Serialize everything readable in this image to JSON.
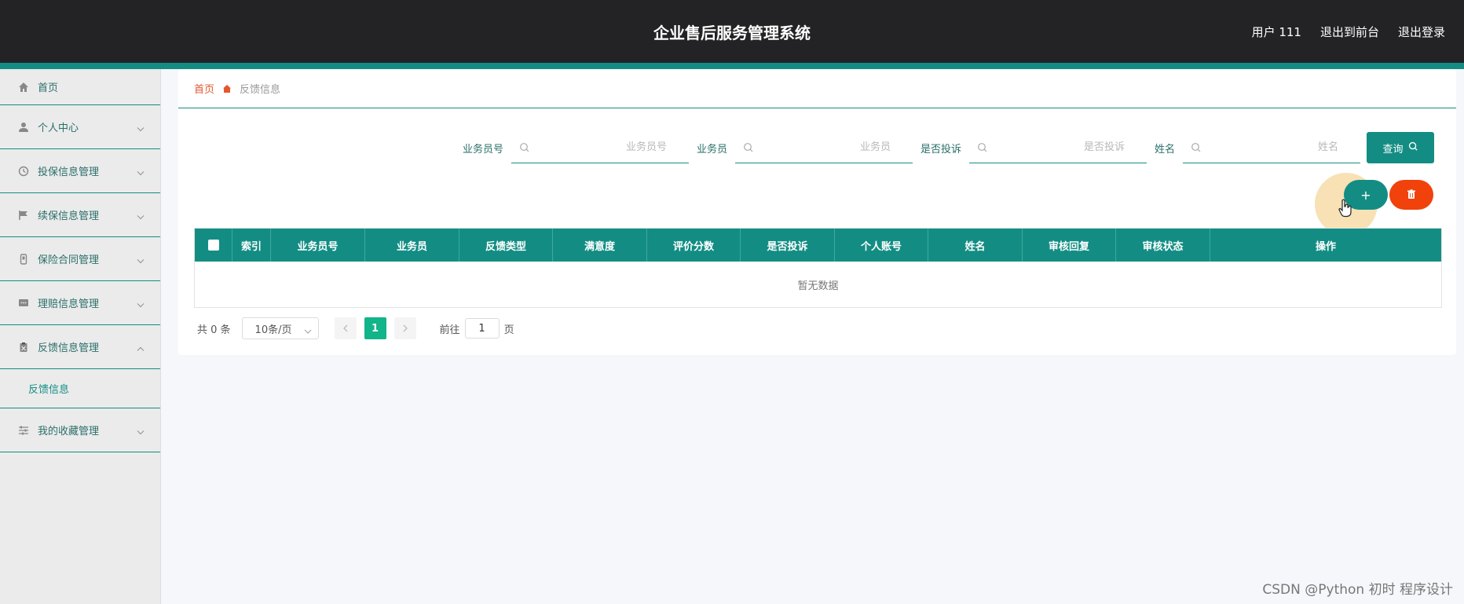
{
  "header": {
    "title": "企业售后服务管理系统",
    "user_label": "用户 111",
    "exit_front": "退出到前台",
    "logout": "退出登录"
  },
  "sidebar": {
    "items": [
      {
        "label": "首页",
        "icon": "home-icon"
      },
      {
        "label": "个人中心",
        "icon": "user-icon"
      },
      {
        "label": "投保信息管理",
        "icon": "clock-icon"
      },
      {
        "label": "续保信息管理",
        "icon": "flag-icon"
      },
      {
        "label": "保险合同管理",
        "icon": "phone-icon"
      },
      {
        "label": "理赔信息管理",
        "icon": "message-icon"
      },
      {
        "label": "反馈信息管理",
        "icon": "clipboard-icon",
        "expanded": true,
        "children": [
          {
            "label": "反馈信息"
          }
        ]
      },
      {
        "label": "我的收藏管理",
        "icon": "sliders-icon"
      }
    ]
  },
  "breadcrumb": {
    "home": "首页",
    "current": "反馈信息"
  },
  "search": {
    "fields": [
      {
        "label": "业务员号",
        "placeholder": "业务员号"
      },
      {
        "label": "业务员",
        "placeholder": "业务员"
      },
      {
        "label": "是否投诉",
        "placeholder": "是否投诉"
      },
      {
        "label": "姓名",
        "placeholder": "姓名"
      }
    ],
    "query_label": "查询"
  },
  "actions": {
    "add_label": "+",
    "delete_icon": "trash-icon"
  },
  "table": {
    "columns": [
      "索引",
      "业务员号",
      "业务员",
      "反馈类型",
      "满意度",
      "评价分数",
      "是否投诉",
      "个人账号",
      "姓名",
      "审核回复",
      "审核状态",
      "操作"
    ],
    "empty_text": "暂无数据"
  },
  "pagination": {
    "total": "共 0 条",
    "page_size": "10条/页",
    "current_page": "1",
    "goto_prefix": "前往",
    "goto_value": "1",
    "goto_suffix": "页"
  },
  "watermark": "CSDN @Python 初时 程序设计",
  "colors": {
    "accent": "#138d84",
    "danger": "#f0420a",
    "header_bg": "#232325",
    "page_active": "#12b48a"
  }
}
